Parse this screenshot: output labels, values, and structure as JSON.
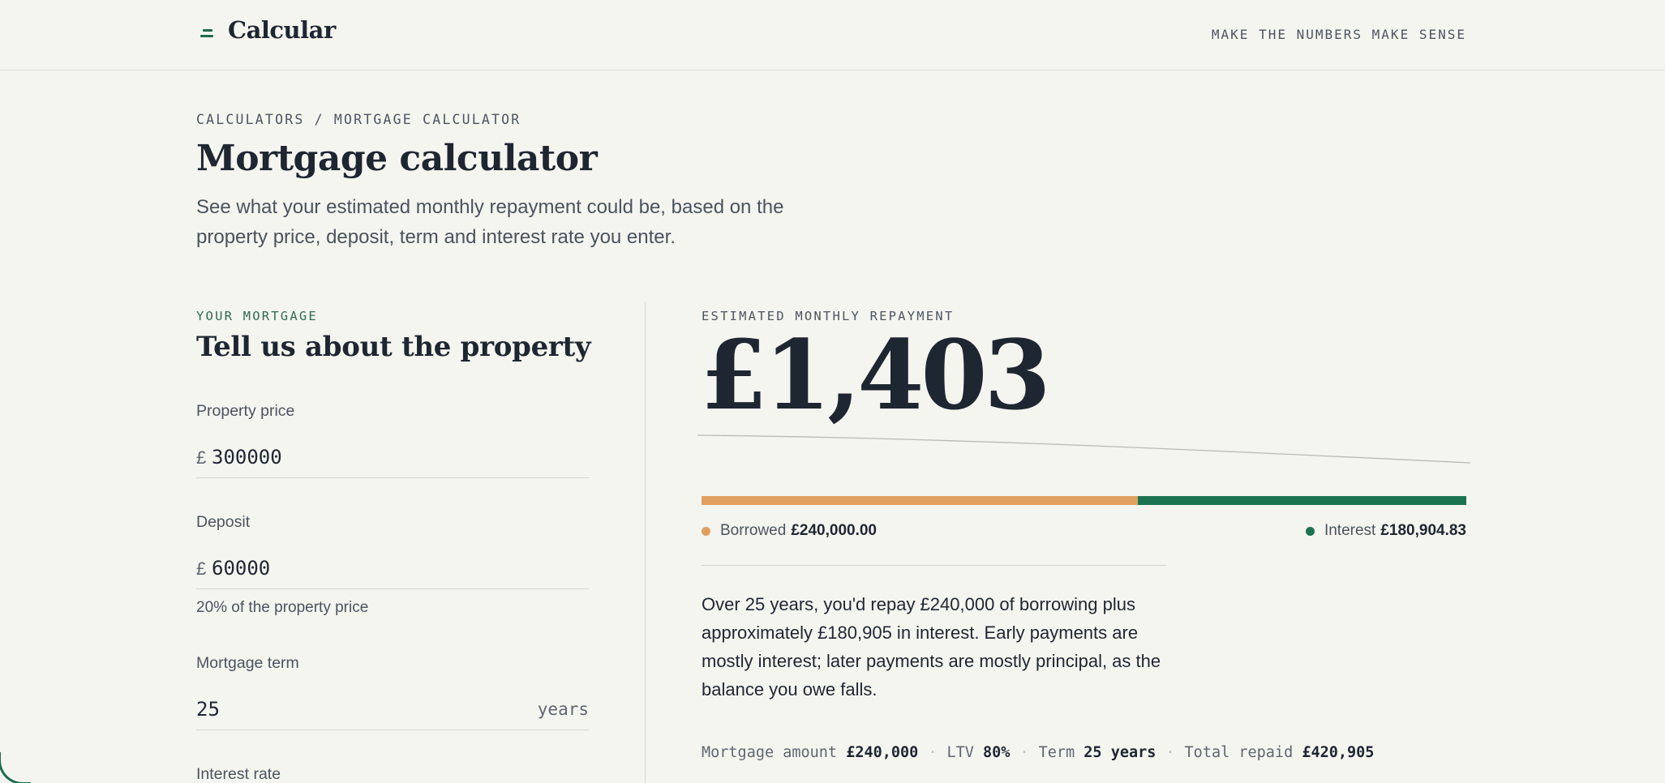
{
  "header": {
    "logo_text": "Calcular",
    "tagline": "MAKE THE NUMBERS MAKE SENSE"
  },
  "breadcrumb": "CALCULATORS / MORTGAGE CALCULATOR",
  "page": {
    "title": "Mortgage calculator",
    "intro": "See what your estimated monthly repayment could be, based on the property price, deposit, term and interest rate you enter."
  },
  "form": {
    "eyebrow": "YOUR MORTGAGE",
    "title": "Tell us about the property",
    "property_price": {
      "label": "Property price",
      "prefix": "£",
      "value": "300000"
    },
    "deposit": {
      "label": "Deposit",
      "prefix": "£",
      "value": "60000",
      "hint": "20% of the property price"
    },
    "term": {
      "label": "Mortgage term",
      "value": "25",
      "suffix": "years"
    },
    "interest_rate": {
      "label": "Interest rate"
    }
  },
  "result": {
    "eyebrow": "ESTIMATED MONTHLY REPAYMENT",
    "amount": "£1,403",
    "split": {
      "borrowed_share": 0.5702,
      "interest_share": 0.4298
    },
    "legend": {
      "borrowed_label": "Borrowed",
      "borrowed_value": "£240,000.00",
      "interest_label": "Interest",
      "interest_value": "£180,904.83"
    },
    "explanation": "Over 25 years, you'd repay £240,000 of borrowing plus approximately £180,905 in interest. Early payments are mostly interest; later payments are mostly principal, as the balance you owe falls.",
    "stats": {
      "mortgage_label": "Mortgage amount",
      "mortgage_value": "£240,000",
      "ltv_label": "LTV",
      "ltv_value": "80%",
      "term_label": "Term",
      "term_value": "25 years",
      "total_label": "Total repaid",
      "total_value": "£420,905"
    }
  },
  "colors": {
    "accent_green": "#1c7352",
    "borrowed_orange": "#e0a060",
    "background": "#f5f5f0",
    "text": "#1e2631"
  }
}
